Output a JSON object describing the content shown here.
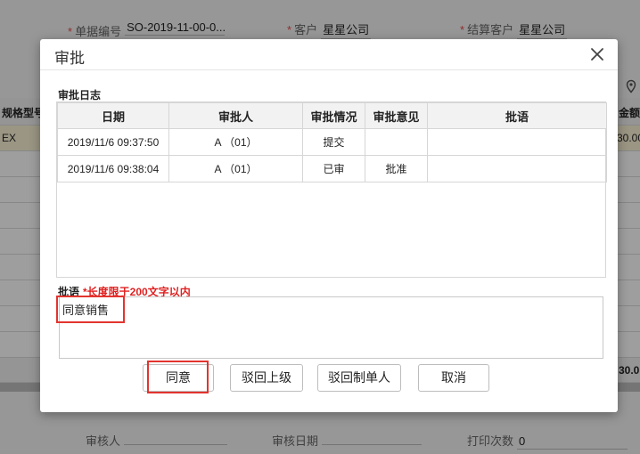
{
  "background": {
    "doc_number_label": "单据编号",
    "doc_number_value": "SO-2019-11-00-0...",
    "customer_label": "客户",
    "customer_value": "星星公司",
    "settle_customer_label": "结算客户",
    "settle_customer_value": "星星公司",
    "column_spec": "规格型号",
    "column_amount": "金额",
    "row_spec": "EX",
    "row_amount": "30.00",
    "total_amount": "30.0",
    "reviewer_label": "审核人",
    "review_date_label": "审核日期",
    "print_count_label": "打印次数",
    "print_count_value": "0"
  },
  "dialog": {
    "title": "审批",
    "log_title": "审批日志",
    "columns": [
      "日期",
      "审批人",
      "审批情况",
      "审批意见",
      "批语"
    ],
    "rows": [
      {
        "date": "2019/11/6 09:37:50",
        "approver": "A （01）",
        "status": "提交",
        "opinion": "",
        "comment": ""
      },
      {
        "date": "2019/11/6 09:38:04",
        "approver": "A （01）",
        "status": "已审",
        "opinion": "批准",
        "comment": ""
      }
    ],
    "comment_label": "批语",
    "comment_hint": "*长度限于200文字以内",
    "comment_value": "同意销售",
    "buttons": {
      "agree": "同意",
      "reject_up": "驳回上级",
      "reject_creator": "驳回制单人",
      "cancel": "取消"
    }
  },
  "colors": {
    "highlight": "#e3342f",
    "hint": "#e02020",
    "required": "#e64a4a"
  }
}
